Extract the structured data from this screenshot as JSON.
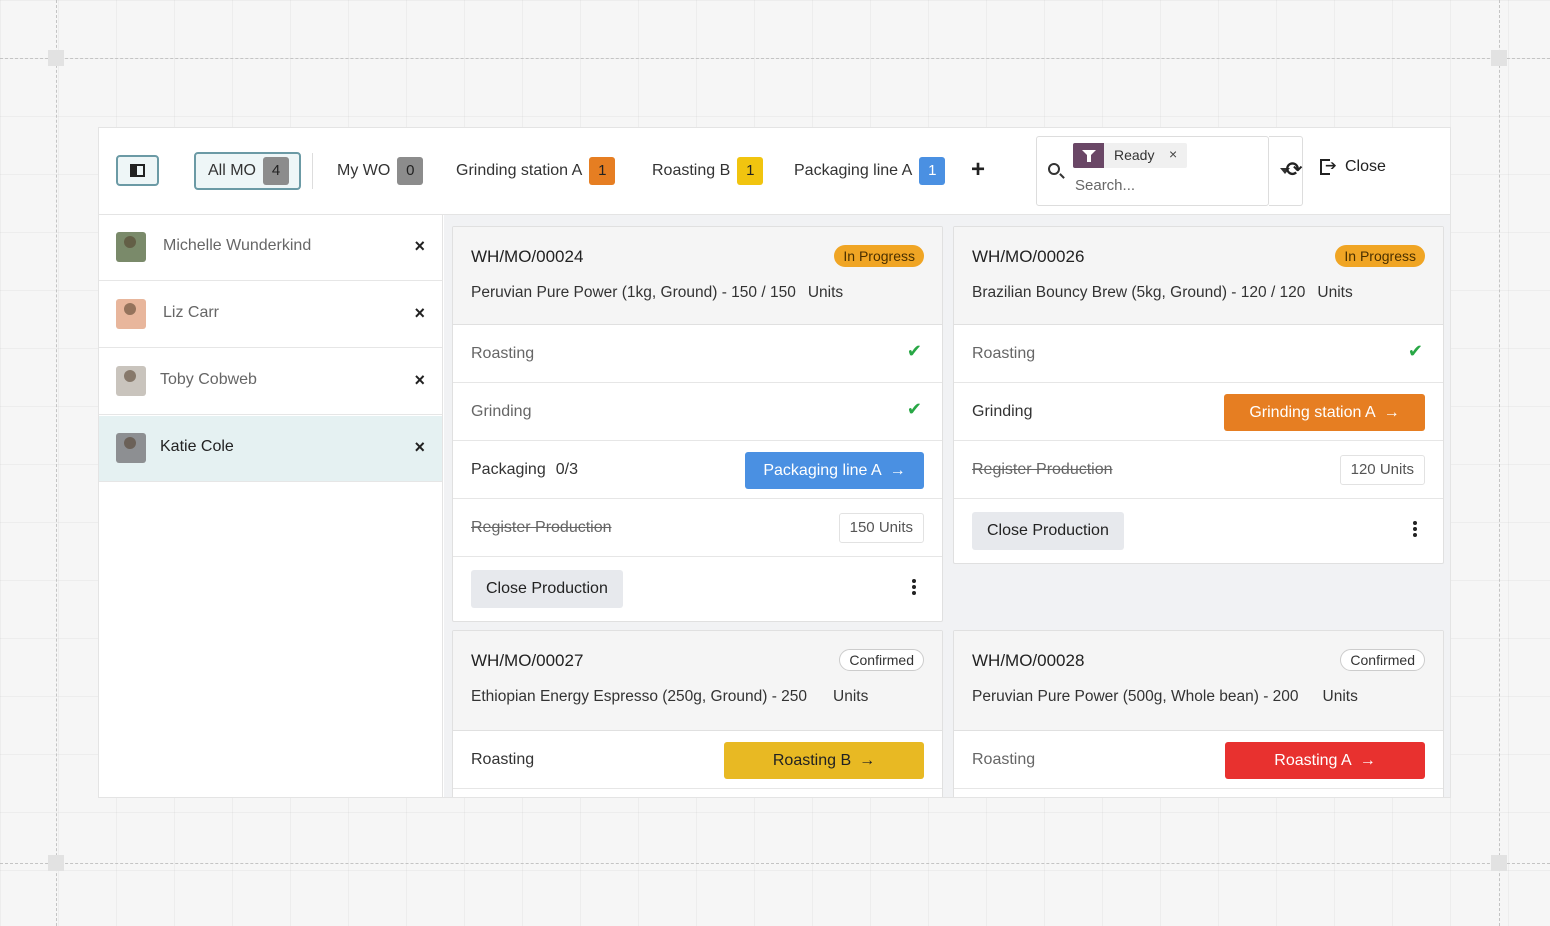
{
  "topbar": {
    "tabs": [
      {
        "label": "All MO",
        "count": "4",
        "count_color": "#8c8c8c"
      },
      {
        "label": "My WO",
        "count": "0",
        "count_color": "#8c8c8c"
      },
      {
        "label": "Grinding station A",
        "count": "1",
        "count_color": "#e67e22"
      },
      {
        "label": "Roasting B",
        "count": "1",
        "count_color": "#f1c40f"
      },
      {
        "label": "Packaging line A",
        "count": "1",
        "count_color": "#4a90e2"
      }
    ],
    "add_tab_icon": "plus-icon",
    "search": {
      "facet_icon": "filter-icon",
      "facet_label": "Ready",
      "facet_remove": "×",
      "placeholder": "Search..."
    },
    "refresh_icon": "refresh-icon",
    "close_label": "Close"
  },
  "sidebar": {
    "employees": [
      {
        "name": "Michelle Wunderkind",
        "remove": "×",
        "active": false
      },
      {
        "name": "Liz Carr",
        "remove": "×",
        "active": false
      },
      {
        "name": "Toby Cobweb",
        "remove": "×",
        "active": false
      },
      {
        "name": "Katie Cole",
        "remove": "×",
        "active": true
      }
    ]
  },
  "cards": [
    {
      "ref": "WH/MO/00024",
      "state": "In Progress",
      "product": "Peruvian Pure Power (1kg, Ground) - 150 / 150",
      "unit": "Units",
      "rows": [
        {
          "label": "Roasting",
          "done": true
        },
        {
          "label": "Grinding",
          "done": true
        },
        {
          "label": "Packaging",
          "qty": "0/3",
          "button": "Packaging line A",
          "button_color": "#4a90e2"
        },
        {
          "label": "Register Production",
          "struck": true,
          "units": "150 Units"
        }
      ],
      "close_label": "Close Production"
    },
    {
      "ref": "WH/MO/00026",
      "state": "In Progress",
      "product": "Brazilian Bouncy Brew (5kg, Ground) - 120 / 120",
      "unit": "Units",
      "rows": [
        {
          "label": "Roasting",
          "done": true
        },
        {
          "label": "Grinding",
          "button": "Grinding station A",
          "button_color": "#e67e22"
        },
        {
          "label": "Register Production",
          "struck": true,
          "units": "120 Units"
        }
      ],
      "close_label": "Close Production"
    },
    {
      "ref": "WH/MO/00027",
      "state": "Confirmed",
      "product": "Ethiopian Energy Espresso (250g, Ground) - 250",
      "unit": "Units",
      "rows": [
        {
          "label": "Roasting",
          "button": "Roasting B",
          "button_color": "#e8b923"
        }
      ]
    },
    {
      "ref": "WH/MO/00028",
      "state": "Confirmed",
      "product": "Peruvian Pure Power (500g, Whole bean) - 200",
      "unit": "Units",
      "rows": [
        {
          "label": "Roasting",
          "button": "Roasting A",
          "button_color": "#e8312f"
        }
      ]
    }
  ],
  "icons": {
    "check": "✔",
    "arrow": "→",
    "refresh": "⟳"
  }
}
